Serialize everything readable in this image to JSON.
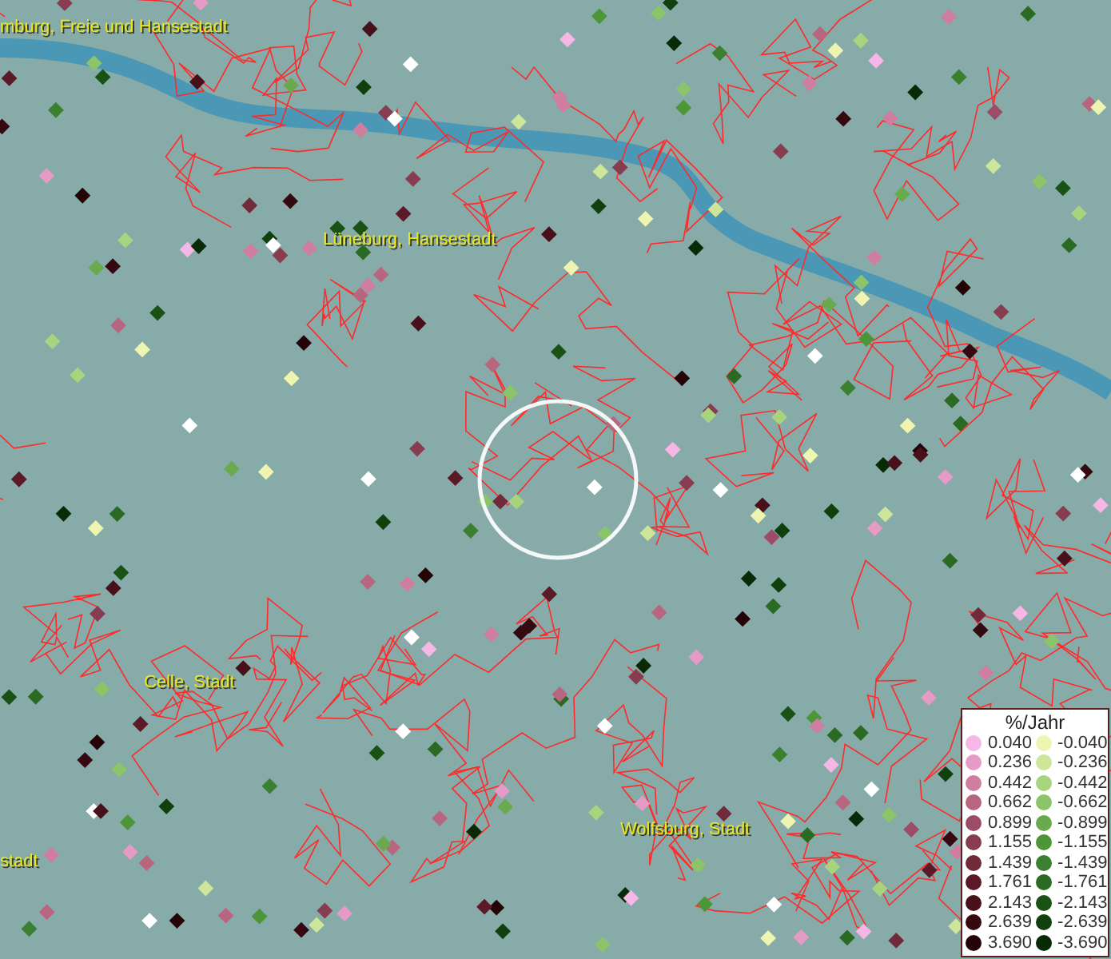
{
  "map": {
    "places": [
      {
        "name": "mburg, Freie und Hansestadt"
      },
      {
        "name": "Lüneburg, Hansestadt"
      },
      {
        "name": "Celle, Stadt"
      },
      {
        "name": "stadt"
      },
      {
        "name": "Wolfsburg, Stadt"
      }
    ]
  },
  "legend": {
    "title": "%/Jahr",
    "positive": [
      {
        "label": "0.040",
        "color": "#f6b6e6"
      },
      {
        "label": "0.236",
        "color": "#e69ac6"
      },
      {
        "label": "0.442",
        "color": "#d07ea0"
      },
      {
        "label": "0.662",
        "color": "#b86680"
      },
      {
        "label": "0.899",
        "color": "#9c4c66"
      },
      {
        "label": "1.155",
        "color": "#883c50"
      },
      {
        "label": "1.439",
        "color": "#702a3a"
      },
      {
        "label": "1.761",
        "color": "#5c1a28"
      },
      {
        "label": "2.143",
        "color": "#48101a"
      },
      {
        "label": "2.639",
        "color": "#360810"
      },
      {
        "label": "3.690",
        "color": "#240406"
      }
    ],
    "negative": [
      {
        "label": "-0.040",
        "color": "#eef5b0"
      },
      {
        "label": "-0.236",
        "color": "#cde69a"
      },
      {
        "label": "-0.442",
        "color": "#a8d47e"
      },
      {
        "label": "-0.662",
        "color": "#8cc46a"
      },
      {
        "label": "-0.899",
        "color": "#6aaa4e"
      },
      {
        "label": "-1.155",
        "color": "#4c9638"
      },
      {
        "label": "-1.439",
        "color": "#3a8030"
      },
      {
        "label": "-1.761",
        "color": "#2a6a22"
      },
      {
        "label": "-2.143",
        "color": "#1a5216"
      },
      {
        "label": "-2.639",
        "color": "#10400e"
      },
      {
        "label": "-3.690",
        "color": "#082a06"
      }
    ]
  }
}
